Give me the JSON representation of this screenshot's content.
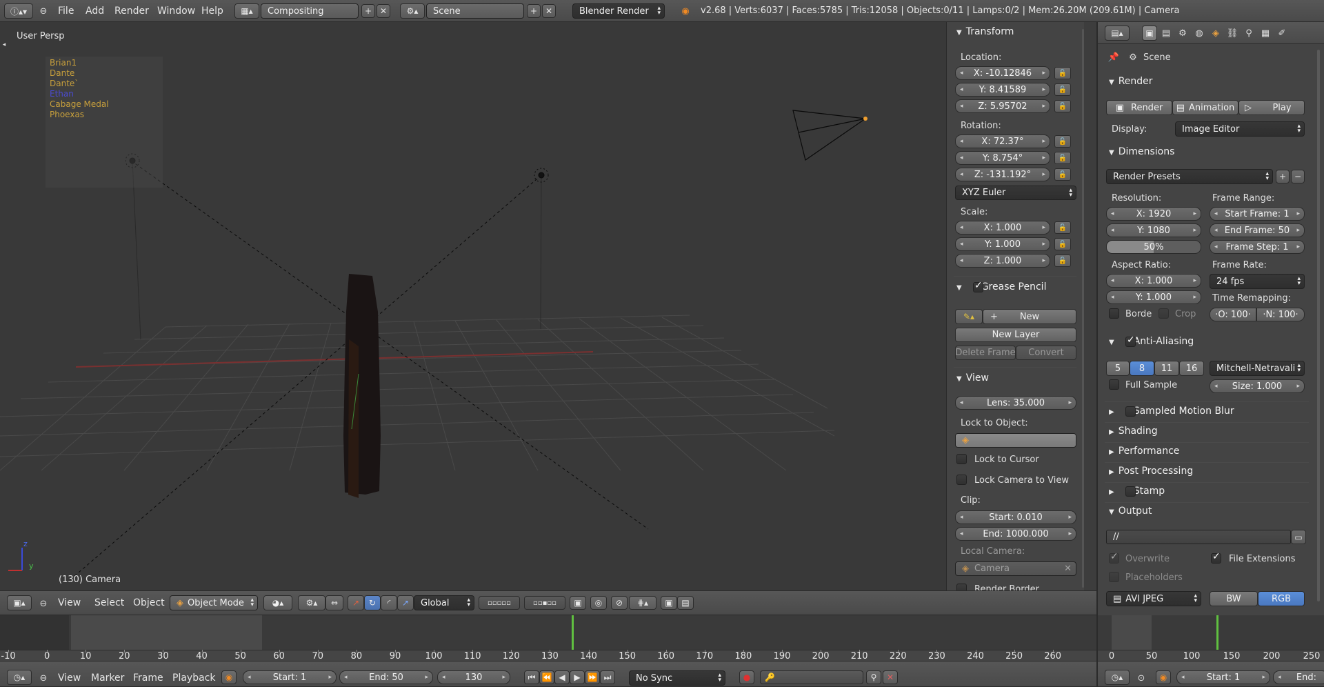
{
  "topbar": {
    "menus": [
      "File",
      "Add",
      "Render",
      "Window",
      "Help"
    ],
    "layout": "Compositing",
    "scene": "Scene",
    "engine": "Blender Render",
    "stats": "v2.68 | Verts:6037 | Faces:5785 | Tris:12058 | Objects:0/11 | Lamps:0/2 | Mem:26.20M (209.61M) | Camera"
  },
  "viewport": {
    "view_name": "User Persp",
    "object_label": "(130) Camera",
    "outliner_items": [
      {
        "name": "Brian1",
        "color": "#c8a03c"
      },
      {
        "name": "Dante",
        "color": "#c8a03c"
      },
      {
        "name": "Dante`",
        "color": "#c8a03c"
      },
      {
        "name": "Ethan",
        "color": "#4b4bd2"
      },
      {
        "name": "Cabage Medal",
        "color": "#c8a03c"
      },
      {
        "name": "Phoexas",
        "color": "#c8a03c"
      }
    ],
    "axis_z": "z",
    "axis_y": "y"
  },
  "nprops": {
    "transform": "Transform",
    "location": "Location:",
    "loc": [
      "X: -10.12846",
      "Y: 8.41589",
      "Z: 5.95702"
    ],
    "rotation": "Rotation:",
    "rot": [
      "X: 72.37°",
      "Y: 8.754°",
      "Z: -131.192°"
    ],
    "rot_mode": "XYZ Euler",
    "scale": "Scale:",
    "scl": [
      "X: 1.000",
      "Y: 1.000",
      "Z: 1.000"
    ],
    "grease_pencil": "Grease Pencil",
    "gp_new": "New",
    "gp_new_layer": "New Layer",
    "gp_delete_frame": "Delete Frame",
    "gp_convert": "Convert",
    "view": "View",
    "lens": "Lens: 35.000",
    "lock_to_object": "Lock to Object:",
    "lock_to_cursor": "Lock to Cursor",
    "lock_camera": "Lock Camera to View",
    "clip": "Clip:",
    "clip_start": "Start: 0.010",
    "clip_end": "End: 1000.000",
    "local_camera": "Local Camera:",
    "camera": "Camera",
    "render_border": "Render Border"
  },
  "viewheader": {
    "menus": [
      "View",
      "Select",
      "Object"
    ],
    "mode": "Object Mode",
    "orientation": "Global"
  },
  "props": {
    "scene": "Scene",
    "render": "Render",
    "render_btn": "Render",
    "animation_btn": "Animation",
    "play_btn": "Play",
    "display_label": "Display:",
    "display": "Image Editor",
    "dimensions": "Dimensions",
    "render_presets": "Render Presets",
    "resolution": "Resolution:",
    "res_x": "X: 1920",
    "res_y": "Y: 1080",
    "res_pct": "50%",
    "frame_range": "Frame Range:",
    "start_frame": "Start Frame: 1",
    "end_frame": "End Frame: 50",
    "frame_step": "Frame Step: 1",
    "aspect_ratio": "Aspect Ratio:",
    "asp_x": "X: 1.000",
    "asp_y": "Y: 1.000",
    "frame_rate_label": "Frame Rate:",
    "frame_rate": "24 fps",
    "time_remapping": "Time Remapping:",
    "remap_old": "·O: 100·",
    "remap_new": "·N: 100·",
    "border": "Borde",
    "crop": "Crop",
    "anti_aliasing": "Anti-Aliasing",
    "aa_samples": [
      "5",
      "8",
      "11",
      "16"
    ],
    "aa_filter": "Mitchell-Netravali",
    "full_sample": "Full Sample",
    "aa_size": "Size: 1.000",
    "sampled_motion_blur": "Sampled Motion Blur",
    "shading": "Shading",
    "performance": "Performance",
    "post_processing": "Post Processing",
    "stamp": "Stamp",
    "output": "Output",
    "output_path": "//",
    "overwrite": "Overwrite",
    "file_extensions": "File Extensions",
    "placeholders": "Placeholders",
    "file_format": "AVI JPEG",
    "bw": "BW",
    "rgb": "RGB"
  },
  "timeline": {
    "ticks": [
      "-10",
      "0",
      "10",
      "20",
      "30",
      "40",
      "50",
      "60",
      "70",
      "80",
      "90",
      "100",
      "110",
      "120",
      "130",
      "140",
      "150",
      "160",
      "170",
      "180",
      "190",
      "200",
      "210",
      "220",
      "230",
      "240",
      "250",
      "260"
    ],
    "menus": [
      "View",
      "Marker",
      "Frame",
      "Playback"
    ],
    "start": "Start: 1",
    "end": "End: 50",
    "current": "130",
    "sync": "No Sync"
  },
  "timeline2": {
    "ticks": [
      "0",
      "50",
      "100",
      "150",
      "200",
      "250"
    ],
    "start": "Start: 1",
    "end": "End: "
  }
}
